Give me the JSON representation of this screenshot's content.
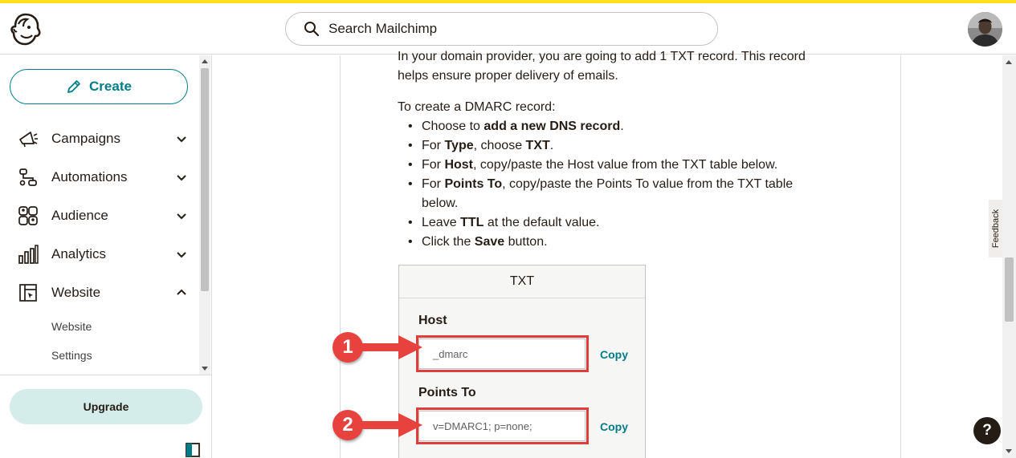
{
  "header": {
    "search_placeholder": "Search Mailchimp",
    "logo_icon": "mailchimp-freddie-icon",
    "avatar_icon": "user-avatar"
  },
  "sidebar": {
    "create_label": "Create",
    "items": [
      {
        "label": "Campaigns",
        "icon": "megaphone-icon",
        "expanded": false
      },
      {
        "label": "Automations",
        "icon": "workflow-icon",
        "expanded": false
      },
      {
        "label": "Audience",
        "icon": "audience-icon",
        "expanded": false
      },
      {
        "label": "Analytics",
        "icon": "bar-chart-icon",
        "expanded": false
      },
      {
        "label": "Website",
        "icon": "website-icon",
        "expanded": true
      }
    ],
    "subitems": [
      "Website",
      "Settings"
    ],
    "upgrade_label": "Upgrade"
  },
  "content": {
    "intro_line1": "In your domain provider, you are going to add 1 TXT record. This record",
    "intro_line2": "helps ensure proper delivery of emails.",
    "steps_heading": "To create a DMARC record:",
    "steps": [
      {
        "pre": "Choose to ",
        "bold": "add a new DNS record",
        "post": "."
      },
      {
        "pre": "For ",
        "bold": "Type",
        "post": ", choose ",
        "bold2": "TXT",
        "post2": "."
      },
      {
        "pre": "For ",
        "bold": "Host",
        "post": ", copy/paste the Host value from the TXT table below."
      },
      {
        "pre": "For ",
        "bold": "Points To",
        "post": ", copy/paste the Points To value from the TXT table below."
      },
      {
        "pre": "Leave ",
        "bold": "TTL",
        "post": " at the default value."
      },
      {
        "pre": "Click the ",
        "bold": "Save",
        "post": " button."
      }
    ],
    "table": {
      "header": "TXT",
      "host_label": "Host",
      "host_value": "_dmarc",
      "points_label": "Points To",
      "points_value": "v=DMARC1; p=none;",
      "copy_label": "Copy"
    },
    "callouts": [
      "1",
      "2"
    ]
  },
  "feedback_label": "Feedback",
  "help_label": "?",
  "colors": {
    "brand_yellow": "#ffe01b",
    "accent_teal": "#007c89",
    "upgrade_bg": "#d4ecea",
    "annotation_red": "#e03c3c"
  }
}
